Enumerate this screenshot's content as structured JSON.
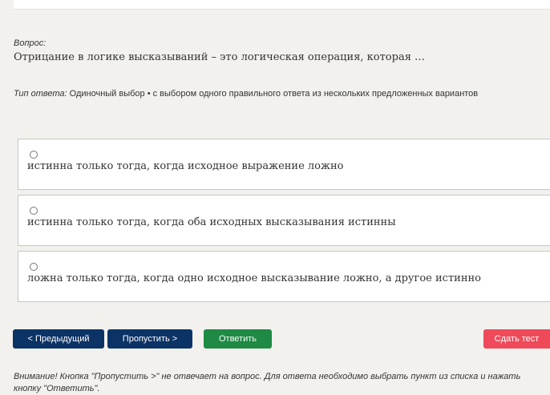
{
  "question": {
    "label": "Вопрос:",
    "text": "Отрицание в логике высказываний – это логическая операция, которая …"
  },
  "answer_type": {
    "label": "Тип ответа:",
    "value": " Одиночный выбор • с выбором одного правильного ответа из нескольких предложенных вариантов"
  },
  "options": [
    {
      "text": "истинна только тогда, когда исходное выражение ложно",
      "selected": false
    },
    {
      "text": "истинна только тогда, когда оба исходных высказывания истинны",
      "selected": false
    },
    {
      "text": "ложна только тогда, когда одно исходное высказывание ложно, а другое истинно",
      "selected": false
    }
  ],
  "buttons": {
    "prev": "< Предыдущий",
    "skip": "Пропустить >",
    "answer": "Ответить",
    "finish": "Сдать тест"
  },
  "notice": "Внимание! Кнопка \"Пропустить >\" не отвечает на вопрос. Для ответа необходимо выбрать пункт из списка и нажать кнопку \"Ответить\".",
  "colors": {
    "page_background": "#f2f1ee",
    "primary_button": "#0c3366",
    "answer_button": "#1e8a43",
    "finish_button": "#ef4a5a",
    "option_border": "#c7c7c7"
  }
}
